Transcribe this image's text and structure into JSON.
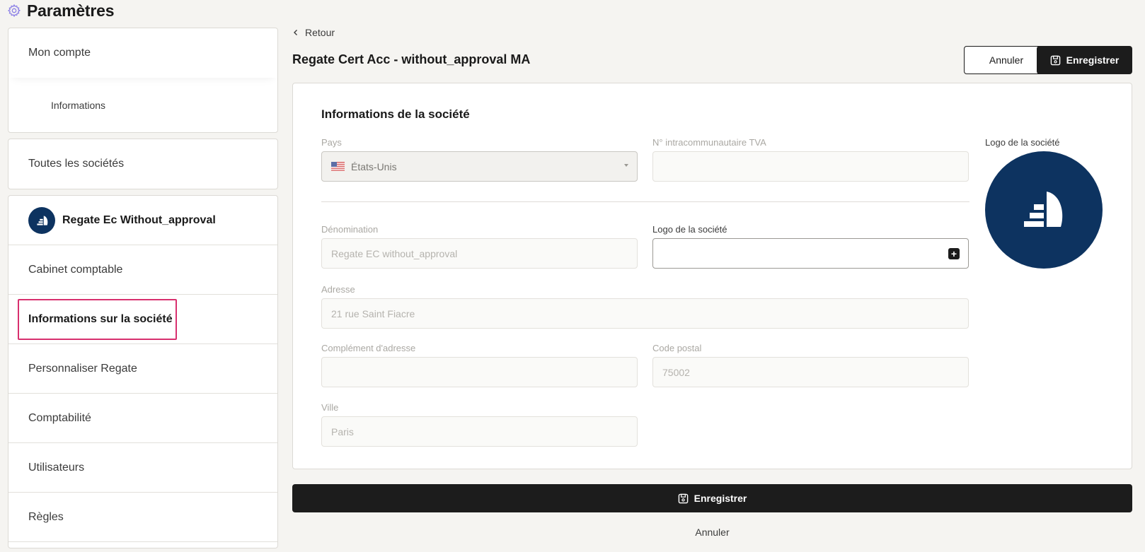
{
  "page": {
    "title": "Paramètres",
    "icon": "gear-icon"
  },
  "sidebar": {
    "account": {
      "label": "Mon compte",
      "sub_item": "Informations"
    },
    "all_companies": "Toutes les sociétés",
    "company": {
      "name": "Regate Ec Without_approval",
      "items": [
        {
          "label": "Cabinet comptable"
        },
        {
          "label": "Informations sur la société",
          "active": true
        },
        {
          "label": "Personnaliser Regate"
        },
        {
          "label": "Comptabilité"
        },
        {
          "label": "Utilisateurs"
        },
        {
          "label": "Règles"
        }
      ]
    }
  },
  "main": {
    "back_label": "Retour",
    "title": "Regate Cert Acc - without_approval MA",
    "cancel_label": "Annuler",
    "save_label": "Enregistrer",
    "form": {
      "section_title": "Informations de la société",
      "country": {
        "label": "Pays",
        "value": "États-Unis",
        "flag": "us-flag-icon"
      },
      "vat": {
        "label": "N° intracommunautaire TVA",
        "value": ""
      },
      "name": {
        "label": "Dénomination",
        "value": "Regate EC without_approval"
      },
      "logo_input": {
        "label": "Logo de la société",
        "value": ""
      },
      "logo_preview": {
        "label": "Logo de la société"
      },
      "address": {
        "label": "Adresse",
        "value": "21 rue Saint Fiacre"
      },
      "address_complement": {
        "label": "Complément d'adresse",
        "value": ""
      },
      "postal_code": {
        "label": "Code postal",
        "value": "75002"
      },
      "city": {
        "label": "Ville",
        "value": "Paris"
      }
    },
    "bottom_save_label": "Enregistrer",
    "bottom_cancel_label": "Annuler"
  },
  "colors": {
    "brand_navy": "#0d3360",
    "highlight": "#d8306e",
    "primary_button": "#1c1c1c",
    "background": "#f5f4f1"
  }
}
